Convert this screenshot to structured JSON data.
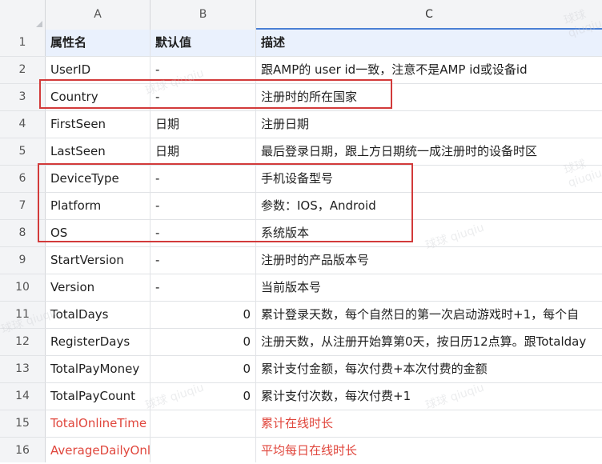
{
  "columns": [
    "A",
    "B",
    "C"
  ],
  "header": {
    "row": "1",
    "a": "属性名",
    "b": "默认值",
    "c": "描述"
  },
  "rows": [
    {
      "num": "2",
      "a": "UserID",
      "b": "-",
      "c": "跟AMP的 user id一致，注意不是AMP id或设备id"
    },
    {
      "num": "3",
      "a": "Country",
      "b": "-",
      "c": "注册时的所在国家"
    },
    {
      "num": "4",
      "a": "FirstSeen",
      "b": "日期",
      "c": "注册日期"
    },
    {
      "num": "5",
      "a": "LastSeen",
      "b": "日期",
      "c": "最后登录日期，跟上方日期统一成注册时的设备时区"
    },
    {
      "num": "6",
      "a": "DeviceType",
      "b": "-",
      "c": "手机设备型号"
    },
    {
      "num": "7",
      "a": "Platform",
      "b": "-",
      "c": "参数：IOS，Android"
    },
    {
      "num": "8",
      "a": "OS",
      "b": "-",
      "c": "系统版本"
    },
    {
      "num": "9",
      "a": "StartVersion",
      "b": "-",
      "c": "注册时的产品版本号"
    },
    {
      "num": "10",
      "a": "Version",
      "b": "-",
      "c": "当前版本号"
    },
    {
      "num": "11",
      "a": "TotalDays",
      "b": "0",
      "c": "累计登录天数，每个自然日的第一次启动游戏时+1，每个自"
    },
    {
      "num": "12",
      "a": "RegisterDays",
      "b": "0",
      "c": "注册天数，从注册开始算第0天，按日历12点算。跟Totalday"
    },
    {
      "num": "13",
      "a": "TotalPayMoney",
      "b": "0",
      "c": "累计支付金额，每次付费+本次付费的金额"
    },
    {
      "num": "14",
      "a": "TotalPayCount",
      "b": "0",
      "c": "累计支付次数，每次付费+1"
    },
    {
      "num": "15",
      "a": "TotalOnlineTime",
      "b": "",
      "c": "累计在线时长"
    },
    {
      "num": "16",
      "a": "AverageDailyOnlineTime",
      "b": "",
      "c": "平均每日在线时长"
    }
  ],
  "watermark": "球球 qiuqiu",
  "colors": {
    "highlight_box": "#d23a3a",
    "red_text": "#e0463c",
    "header_fill": "#eaf1fd"
  }
}
